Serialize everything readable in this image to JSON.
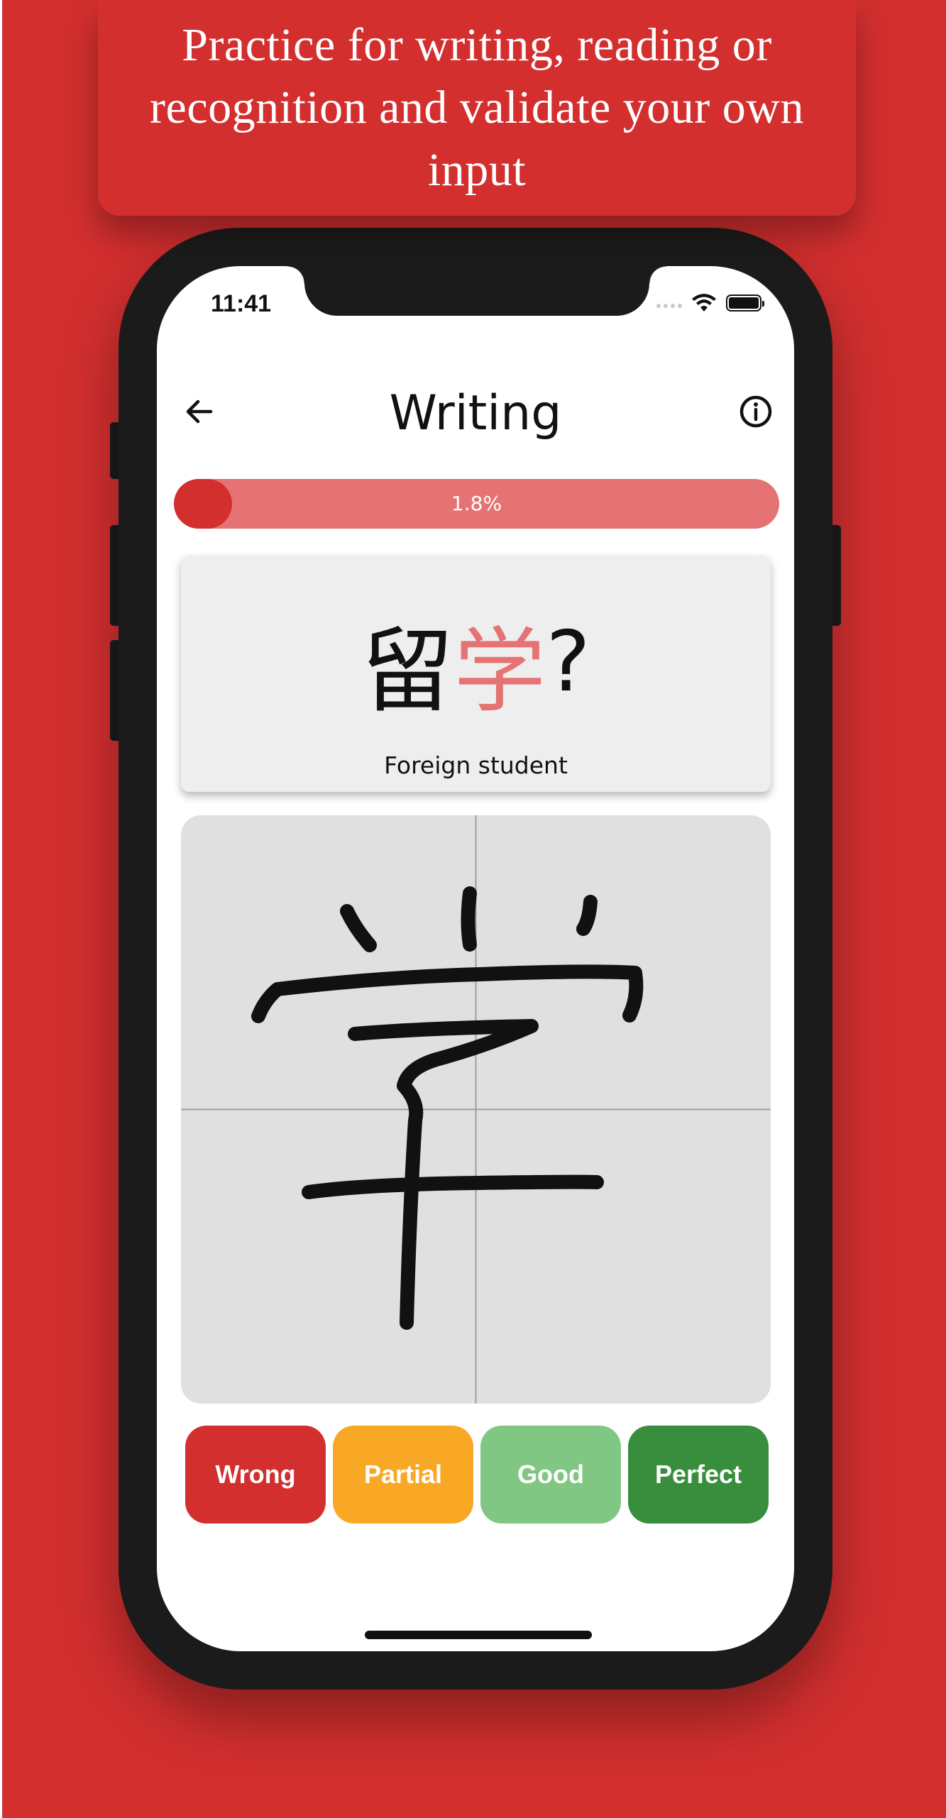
{
  "caption": {
    "text": "Practice for writing, reading or recognition and validate your own input"
  },
  "status_bar": {
    "time": "11:41",
    "icons": [
      "signal-icon",
      "wifi-icon",
      "battery-icon"
    ]
  },
  "app_bar": {
    "title": "Writing",
    "back_icon": "arrow-left-icon",
    "info_icon": "info-icon"
  },
  "progress": {
    "value": 0.018,
    "label": "1.8%"
  },
  "prompt": {
    "known_char": "留",
    "target_char": "学",
    "question_mark": "?",
    "meaning": "Foreign student"
  },
  "canvas": {
    "drawn_character": "学",
    "guides": "cross"
  },
  "grades": [
    {
      "label": "Wrong",
      "color": "#d32f2f"
    },
    {
      "label": "Partial",
      "color": "#f9a825"
    },
    {
      "label": "Good",
      "color": "#81c784"
    },
    {
      "label": "Perfect",
      "color": "#388e3c"
    }
  ],
  "colors": {
    "background": "#d32f2f",
    "accent_light": "#e57373",
    "card": "#eeeeee",
    "canvas": "#e0e0e0"
  }
}
